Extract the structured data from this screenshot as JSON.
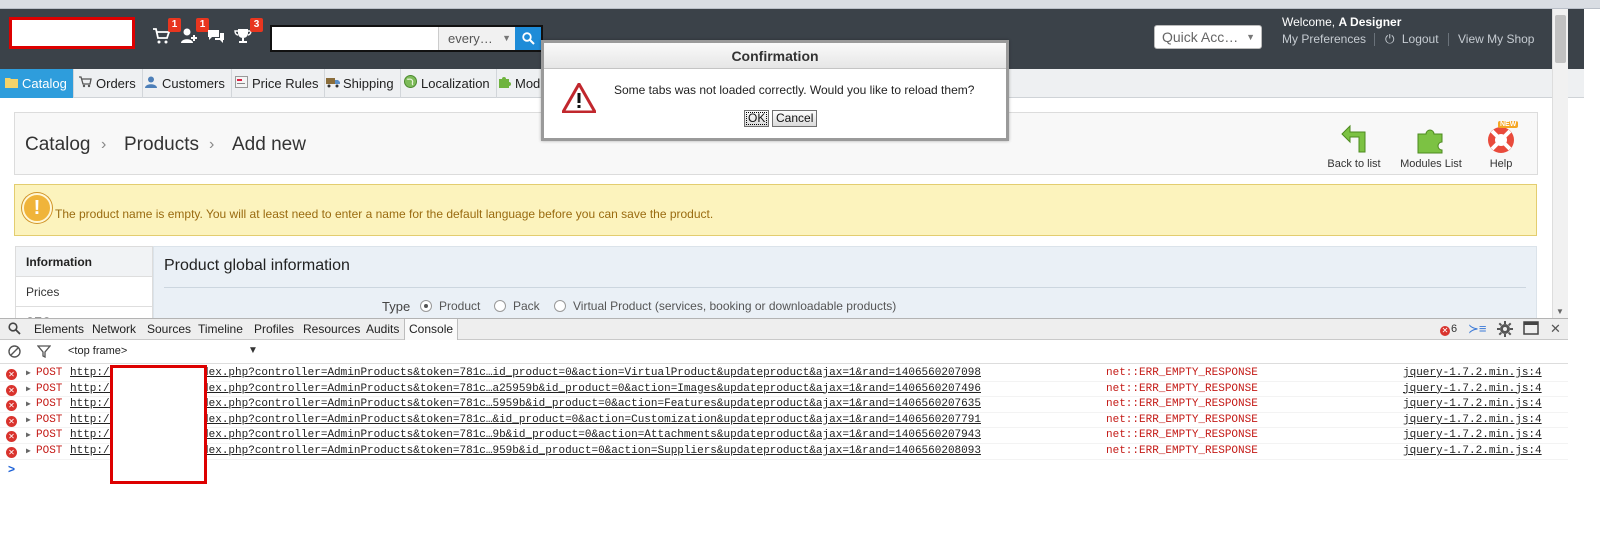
{
  "header": {
    "badges": {
      "cart": "1",
      "customers": "1",
      "messages": "",
      "trophy": "3"
    },
    "search": {
      "value": "",
      "scope": "every…"
    },
    "quick_access": "Quick Acc…",
    "welcome_prefix": "Welcome,",
    "welcome_name": "A Designer",
    "links": {
      "preferences": "My Preferences",
      "logout": "Logout",
      "view_shop": "View My Shop"
    }
  },
  "tabs": [
    {
      "label": "Catalog",
      "icon": "folder-icon"
    },
    {
      "label": "Orders",
      "icon": "cart-icon"
    },
    {
      "label": "Customers",
      "icon": "user-icon"
    },
    {
      "label": "Price Rules",
      "icon": "price-icon"
    },
    {
      "label": "Shipping",
      "icon": "truck-icon"
    },
    {
      "label": "Localization",
      "icon": "globe-icon"
    },
    {
      "label": "Modu",
      "icon": "puzzle-icon"
    }
  ],
  "breadcrumb": {
    "level1": "Catalog",
    "level2": "Products",
    "level3": "Add new"
  },
  "toolbar": {
    "back": "Back to list",
    "modules": "Modules List",
    "help": "Help",
    "help_new": "NEW"
  },
  "warning": "The product name is empty. You will at least need to enter a name for the default language before you can save the product.",
  "side_tabs": [
    "Information",
    "Prices",
    "SEO"
  ],
  "form": {
    "title": "Product global information",
    "type_label": "Type",
    "options": [
      "Product",
      "Pack",
      "Virtual Product (services, booking or downloadable products)"
    ],
    "selected": "Product"
  },
  "dialog": {
    "title": "Confirmation",
    "message": "Some tabs was not loaded correctly. Would you like to reload them?",
    "ok": "OK",
    "cancel": "Cancel"
  },
  "devtools": {
    "tabs": [
      "Elements",
      "Network",
      "Sources",
      "Timeline",
      "Profiles",
      "Resources",
      "Audits",
      "Console"
    ],
    "active_tab": "Console",
    "error_count": "6",
    "frame": "<top frame>",
    "rows": [
      {
        "method": "POST",
        "url": "http://            admin0574/index.php?controller=AdminProducts&token=781c…id_product=0&action=VirtualProduct&updateproduct&ajax=1&rand=1406560207098",
        "error": "net::ERR_EMPTY_RESPONSE",
        "source": "jquery-1.7.2.min.js:4"
      },
      {
        "method": "POST",
        "url": "http://            admin0574/index.php?controller=AdminProducts&token=781c…a25959b&id_product=0&action=Images&updateproduct&ajax=1&rand=1406560207496",
        "error": "net::ERR_EMPTY_RESPONSE",
        "source": "jquery-1.7.2.min.js:4"
      },
      {
        "method": "POST",
        "url": "http://            admin0574/index.php?controller=AdminProducts&token=781c…5959b&id_product=0&action=Features&updateproduct&ajax=1&rand=1406560207635",
        "error": "net::ERR_EMPTY_RESPONSE",
        "source": "jquery-1.7.2.min.js:4"
      },
      {
        "method": "POST",
        "url": "http://            admin0574/index.php?controller=AdminProducts&token=781c…&id_product=0&action=Customization&updateproduct&ajax=1&rand=1406560207791",
        "error": "net::ERR_EMPTY_RESPONSE",
        "source": "jquery-1.7.2.min.js:4"
      },
      {
        "method": "POST",
        "url": "http://            admin0574/index.php?controller=AdminProducts&token=781c…9b&id_product=0&action=Attachments&updateproduct&ajax=1&rand=1406560207943",
        "error": "net::ERR_EMPTY_RESPONSE",
        "source": "jquery-1.7.2.min.js:4"
      },
      {
        "method": "POST",
        "url": "http://            admin0574/index.php?controller=AdminProducts&token=781c…959b&id_product=0&action=Suppliers&updateproduct&ajax=1&rand=1406560208093",
        "error": "net::ERR_EMPTY_RESPONSE",
        "source": "jquery-1.7.2.min.js:4"
      }
    ],
    "prompt": ">"
  },
  "colors": {
    "header_bg": "#3b4249",
    "active_tab": "#2e9ddc",
    "error_red": "#c41a16",
    "warning_bg": "#fcf3bd"
  }
}
